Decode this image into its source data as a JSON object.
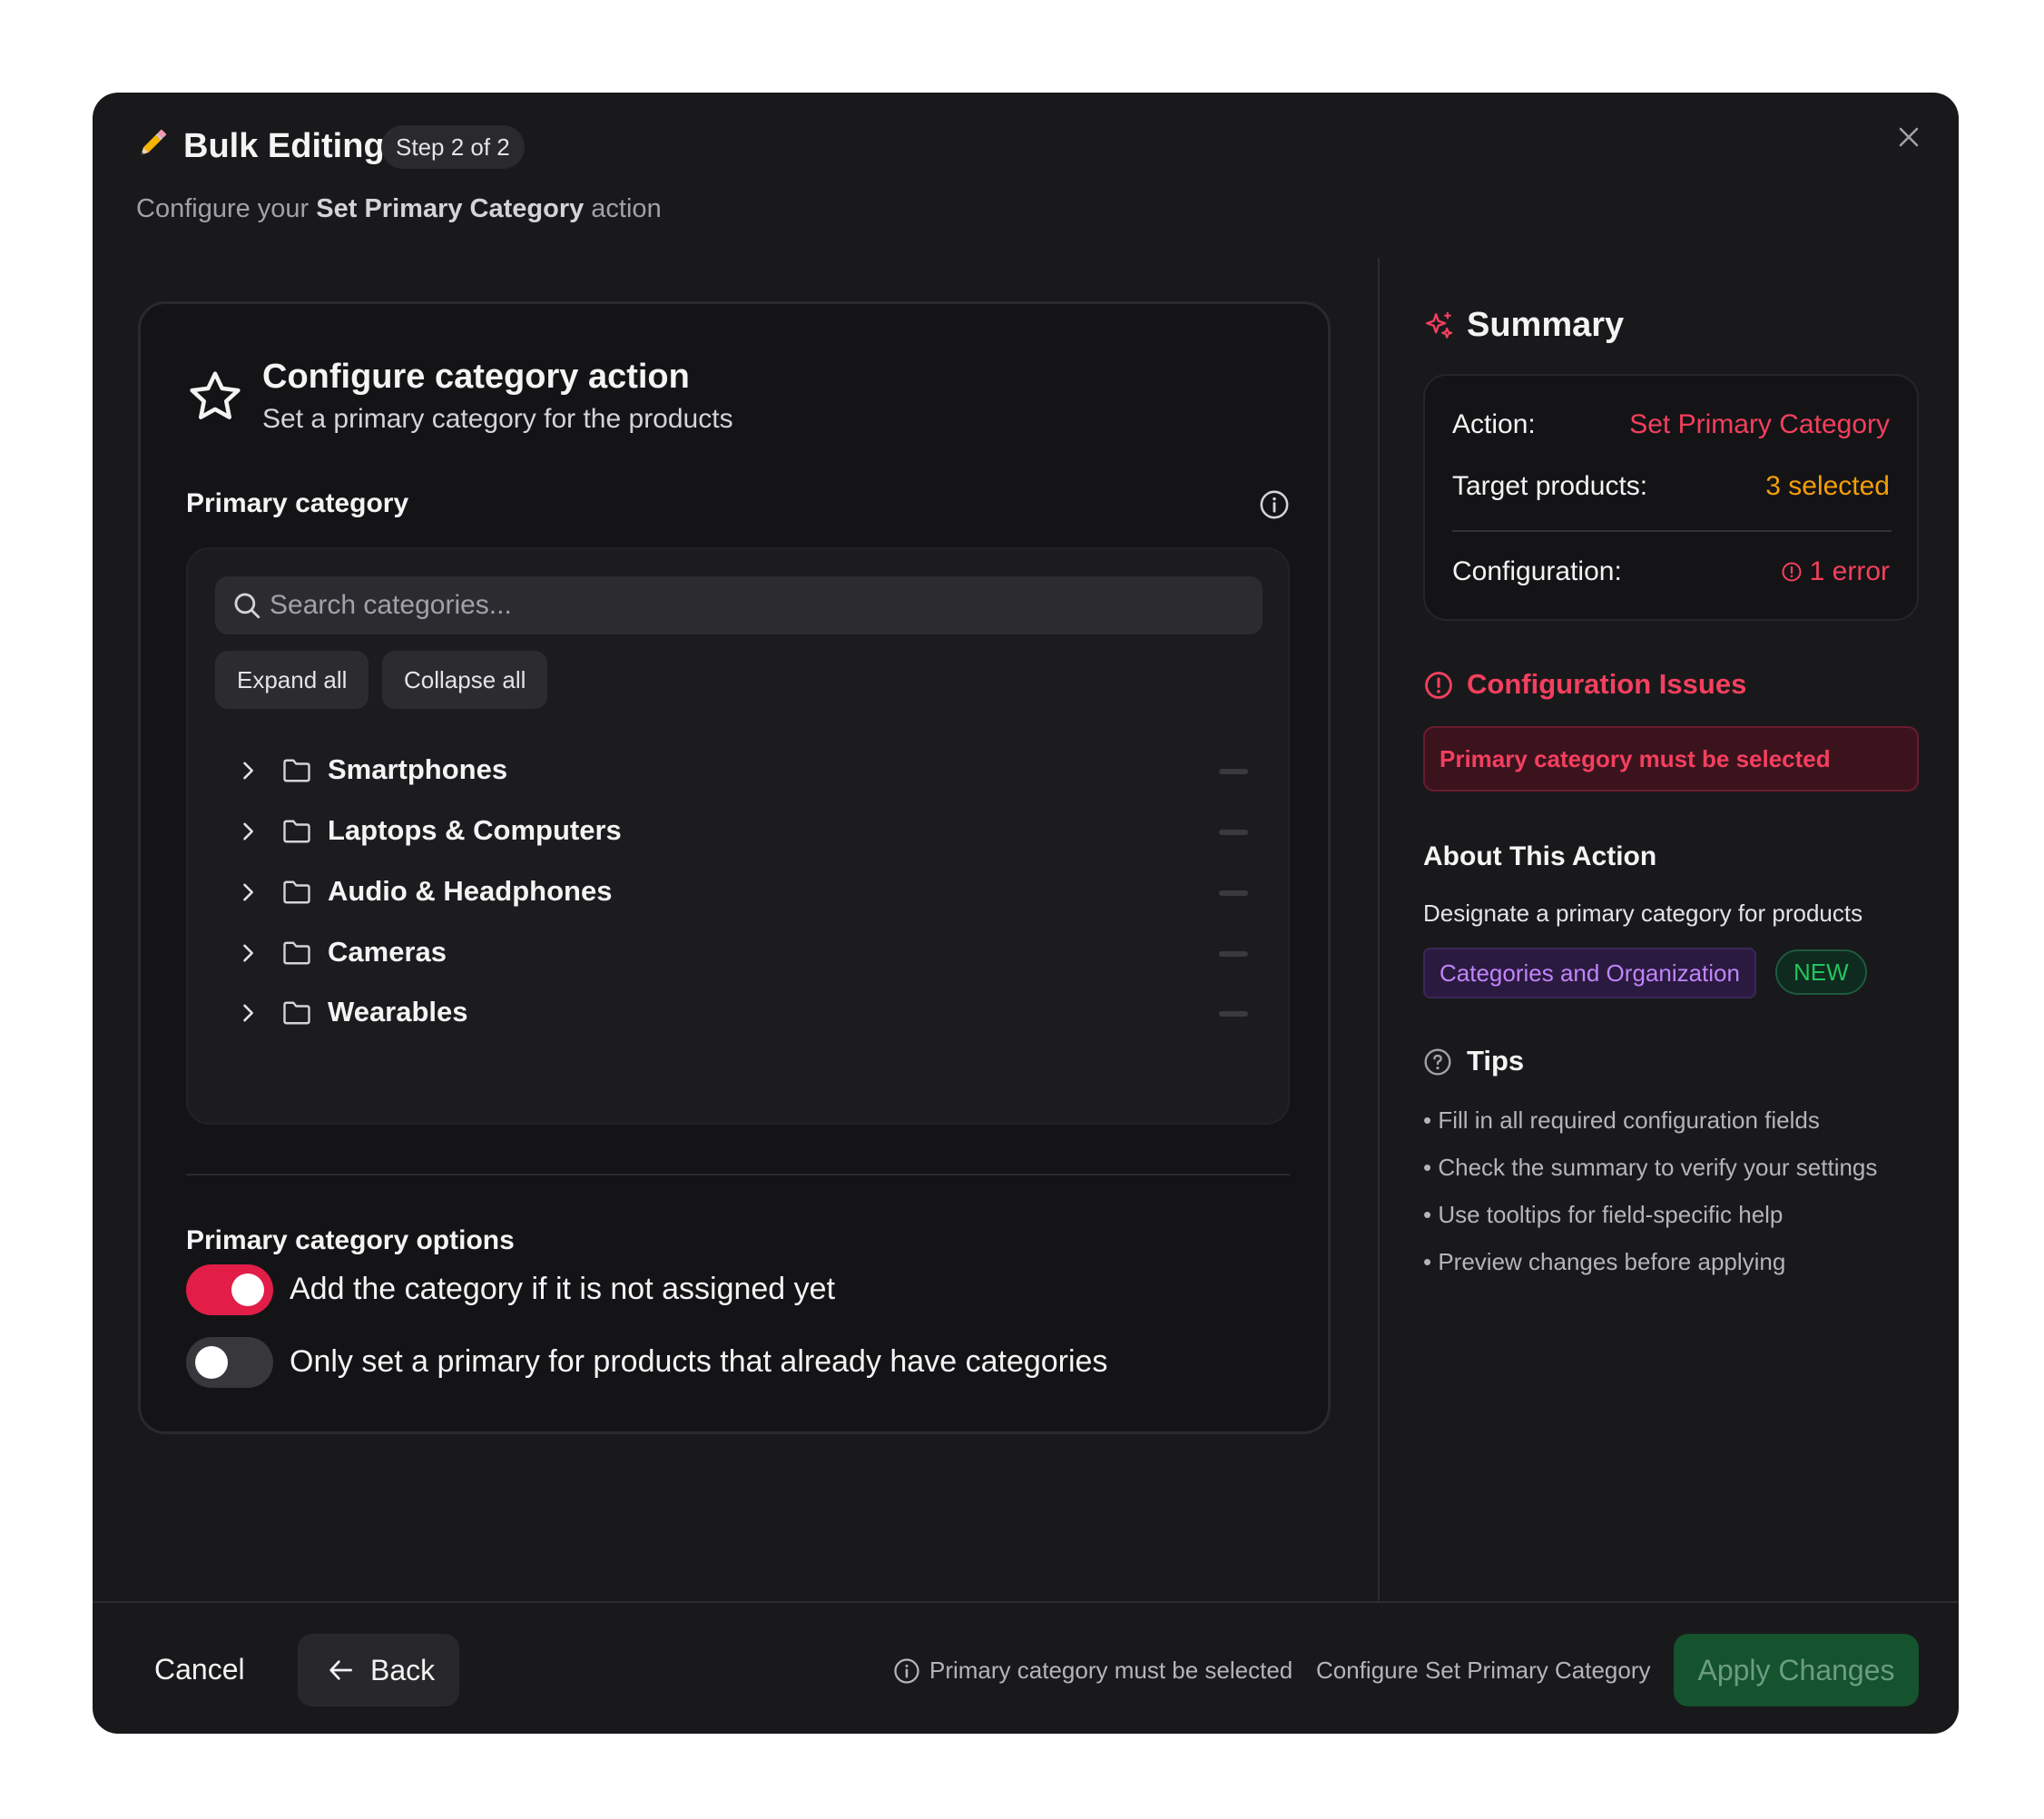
{
  "header": {
    "title": "Bulk Editing",
    "step_badge": "Step 2 of 2",
    "subtitle_prefix": "Configure your ",
    "subtitle_action": "Set Primary Category",
    "subtitle_suffix": " action",
    "icons": {
      "title": "pencil-icon",
      "close": "close-icon"
    }
  },
  "config_card": {
    "title": "Configure category action",
    "subtitle": "Set a primary category for the products",
    "icon": "star-icon",
    "primary_category_label": "Primary category",
    "search_placeholder": "Search categories...",
    "expand_all": "Expand all",
    "collapse_all": "Collapse all",
    "categories": [
      {
        "label": "Smartphones"
      },
      {
        "label": "Laptops & Computers"
      },
      {
        "label": "Audio & Headphones"
      },
      {
        "label": "Cameras"
      },
      {
        "label": "Wearables"
      }
    ],
    "options_label": "Primary category options",
    "options": [
      {
        "label": "Add the category if it is not assigned yet",
        "enabled": true
      },
      {
        "label": "Only set a primary for products that already have categories",
        "enabled": false
      }
    ]
  },
  "summary": {
    "title": "Summary",
    "icon": "sparkles-icon",
    "action_key": "Action:",
    "action_value": "Set Primary Category",
    "target_key": "Target products:",
    "target_value": "3 selected",
    "config_key": "Configuration:",
    "config_value": "1 error",
    "colors": {
      "action": "#f43f5e",
      "target": "#f59e0b",
      "error": "#f43f5e"
    }
  },
  "issues": {
    "title": "Configuration Issues",
    "items": [
      "Primary category must be selected"
    ]
  },
  "about": {
    "title": "About This Action",
    "description": "Designate a primary category for products",
    "tag": "Categories and Organization",
    "badge": "NEW"
  },
  "tips": {
    "title": "Tips",
    "items": [
      "Fill in all required configuration fields",
      "Check the summary to verify your settings",
      "Use tooltips for field-specific help",
      "Preview changes before applying"
    ]
  },
  "footer": {
    "cancel": "Cancel",
    "back": "Back",
    "status_message": "Primary category must be selected",
    "configure_text": "Configure Set Primary Category",
    "apply": "Apply Changes"
  }
}
